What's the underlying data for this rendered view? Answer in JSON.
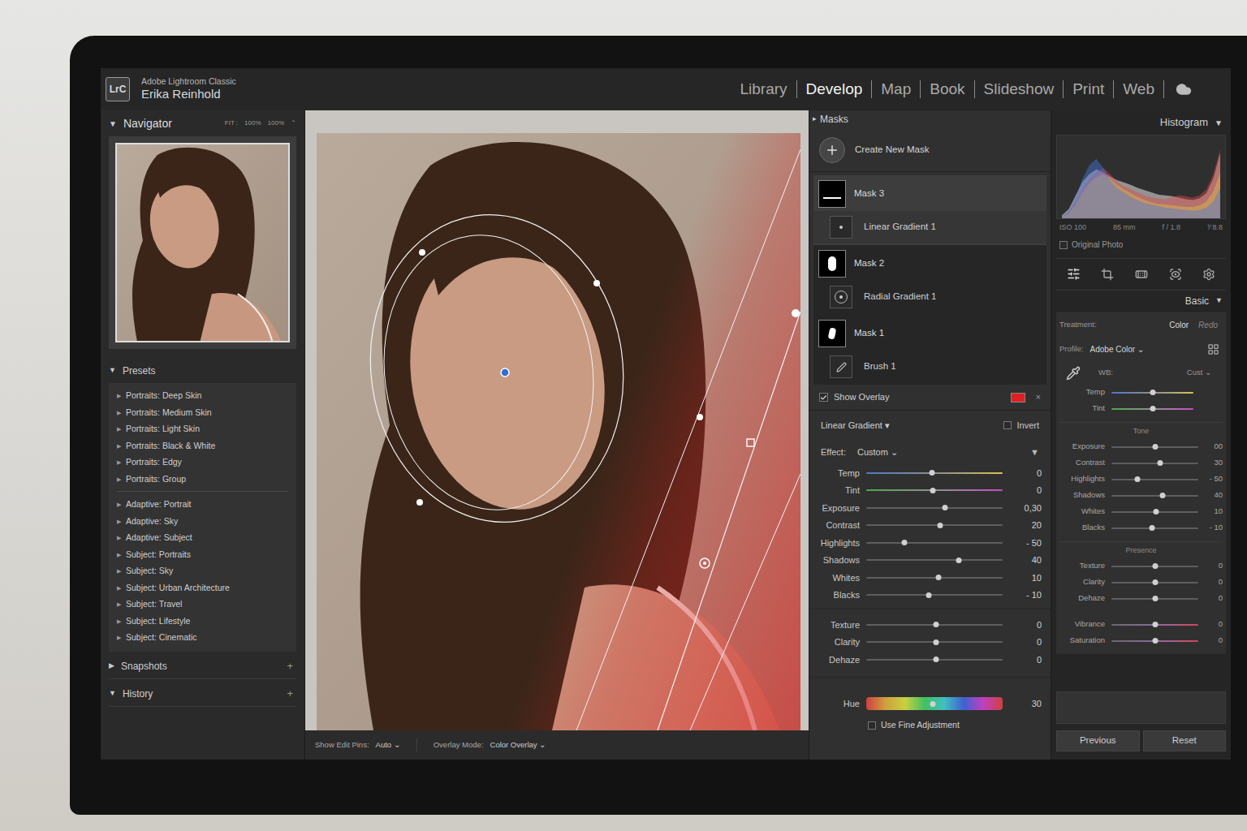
{
  "app": {
    "logo": "LrC",
    "product": "Adobe Lightroom Classic",
    "user": "Erika Reinhold"
  },
  "modules": [
    {
      "label": "Library",
      "selected": false
    },
    {
      "label": "Develop",
      "selected": true
    },
    {
      "label": "Map",
      "selected": false
    },
    {
      "label": "Book",
      "selected": false
    },
    {
      "label": "Slideshow",
      "selected": false
    },
    {
      "label": "Print",
      "selected": false
    },
    {
      "label": "Web",
      "selected": false
    }
  ],
  "navigator": {
    "toggle": "▼",
    "title": "Navigator",
    "expanded": true,
    "zoom": [
      "FIT :",
      "100%",
      "100%",
      "⌃"
    ]
  },
  "presets": {
    "toggle": "▼",
    "title": "Presets",
    "expanded": true,
    "item_toggle": "▶",
    "groups": [
      [
        "Portraits: Deep Skin",
        "Portraits: Medium Skin",
        "Portraits: Light Skin",
        "Portraits: Black & White",
        "Portraits: Edgy",
        "Portraits: Group"
      ],
      [
        "Adaptive: Portrait",
        "Adaptive: Sky",
        "Adaptive: Subject",
        "Subject: Portraits",
        "Subject: Sky",
        "Subject: Urban Architecture",
        "Subject: Travel",
        "Subject: Lifestyle",
        "Subject: Cinematic"
      ]
    ]
  },
  "snapshots": {
    "toggle": "▶",
    "title": "Snapshots",
    "expanded": false,
    "add": "+"
  },
  "history": {
    "toggle": "▼",
    "title": "History",
    "expanded": true,
    "add": "+"
  },
  "toolbar": {
    "edit_pins_label": "Show Edit Pins:",
    "edit_pins": "Auto",
    "overlay_label": "Overlay Mode:",
    "overlay_mode": "Color Overlay",
    "caret": "⌄"
  },
  "masks": {
    "toggle": "▸",
    "title": "Masks",
    "create": "Create New Mask",
    "items": [
      {
        "name": "Mask 3",
        "selected": true,
        "components": [
          {
            "name": "Linear Gradient 1",
            "kind": "linear",
            "selected": true
          }
        ]
      },
      {
        "name": "Mask 2",
        "selected": false,
        "components": [
          {
            "name": "Radial Gradient 1",
            "kind": "radial",
            "selected": false
          }
        ]
      },
      {
        "name": "Mask 1",
        "selected": false,
        "components": [
          {
            "name": "Brush 1",
            "kind": "brush",
            "selected": false
          }
        ]
      }
    ],
    "show_overlay": {
      "label": "Show Overlay",
      "checked": true,
      "color": "#e02020",
      "close": "×"
    }
  },
  "adjust": {
    "title": "Linear Gradient",
    "caret": "▾",
    "invert": {
      "label": "Invert",
      "checked": false
    },
    "effect_label": "Effect:",
    "effect": "Custom",
    "effect_caret": "⌄",
    "collapse": "▼",
    "groups": [
      [
        {
          "label": "Temp",
          "value": "0",
          "level": 0.48,
          "kind": "temp"
        },
        {
          "label": "Tint",
          "value": "0",
          "level": 0.49,
          "kind": "tint"
        },
        {
          "label": "Exposure",
          "value": "0,30",
          "level": 0.58,
          "kind": "plain"
        },
        {
          "label": "Contrast",
          "value": "20",
          "level": 0.54,
          "kind": "plain"
        },
        {
          "label": "Highlights",
          "value": "- 50",
          "level": 0.28,
          "kind": "plain"
        },
        {
          "label": "Shadows",
          "value": "40",
          "level": 0.68,
          "kind": "plain"
        },
        {
          "label": "Whites",
          "value": "10",
          "level": 0.53,
          "kind": "plain"
        },
        {
          "label": "Blacks",
          "value": "- 10",
          "level": 0.46,
          "kind": "plain"
        }
      ],
      [
        {
          "label": "Texture",
          "value": "0",
          "level": 0.51,
          "kind": "plain"
        },
        {
          "label": "Clarity",
          "value": "0",
          "level": 0.51,
          "kind": "plain"
        },
        {
          "label": "Dehaze",
          "value": "0",
          "level": 0.51,
          "kind": "plain"
        }
      ],
      [
        {
          "label": "Hue",
          "value": "30",
          "level": 0.49,
          "kind": "hue"
        }
      ]
    ],
    "fine": {
      "label": "Use Fine Adjustment",
      "checked": false
    }
  },
  "histogram": {
    "title": "Histogram",
    "toggle": "▼",
    "info": [
      "ISO 100",
      "85 mm",
      "f / 1.8",
      "⅟ 8.8"
    ],
    "original_photo": {
      "label": "Original Photo",
      "checked": false
    },
    "series": [
      {
        "name": "luminance",
        "color": "#bdbdbd",
        "values": [
          4,
          12,
          30,
          48,
          58,
          64,
          60,
          55,
          50,
          47,
          44,
          40,
          37,
          34,
          31,
          30,
          29,
          27,
          25,
          24,
          26,
          33,
          52,
          85
        ]
      },
      {
        "name": "red",
        "color": "#e04848",
        "values": [
          2,
          8,
          22,
          40,
          52,
          60,
          66,
          58,
          48,
          42,
          38,
          34,
          30,
          27,
          26,
          25,
          28,
          30,
          29,
          27,
          30,
          38,
          58,
          90
        ]
      },
      {
        "name": "green",
        "color": "#e0c040",
        "values": [
          2,
          6,
          18,
          34,
          46,
          54,
          58,
          52,
          44,
          38,
          33,
          28,
          24,
          21,
          19,
          18,
          17,
          16,
          15,
          15,
          17,
          22,
          35,
          60
        ]
      },
      {
        "name": "blue",
        "color": "#4878e0",
        "values": [
          3,
          10,
          28,
          52,
          70,
          78,
          66,
          50,
          40,
          34,
          28,
          24,
          20,
          18,
          16,
          14,
          13,
          12,
          11,
          10,
          11,
          14,
          22,
          40
        ]
      }
    ]
  },
  "basic": {
    "title": "Basic",
    "toggle": "▼",
    "treatment_label": "Treatment:",
    "treatment": [
      {
        "label": "Color",
        "selected": true
      },
      {
        "label": "Redo",
        "selected": false
      }
    ],
    "profile_label": "Profile:",
    "profile": "Adobe Color",
    "profile_caret": "⌄",
    "wb_label": "WB:",
    "wb": "Cust",
    "wb_caret": "⌄",
    "wb_sliders": [
      {
        "label": "Temp",
        "level": 0.5,
        "kind": "temp"
      },
      {
        "label": "Tint",
        "level": 0.5,
        "kind": "tint"
      }
    ],
    "tone_title": "Tone",
    "tone": [
      {
        "label": "Exposure",
        "value": "00",
        "level": 0.5,
        "kind": "plain"
      },
      {
        "label": "Contrast",
        "value": "30",
        "level": 0.56,
        "kind": "plain"
      },
      {
        "label": "Highlights",
        "value": "- 50",
        "level": 0.3,
        "kind": "plain"
      },
      {
        "label": "Shadows",
        "value": "40",
        "level": 0.59,
        "kind": "plain"
      },
      {
        "label": "Whites",
        "value": "10",
        "level": 0.51,
        "kind": "plain"
      },
      {
        "label": "Blacks",
        "value": "- 10",
        "level": 0.47,
        "kind": "plain"
      }
    ],
    "presence_title": "Presence",
    "presence": [
      {
        "label": "Texture",
        "value": "0",
        "level": 0.5,
        "kind": "plain"
      },
      {
        "label": "Clarity",
        "value": "0",
        "level": 0.5,
        "kind": "plain"
      },
      {
        "label": "Dehaze",
        "value": "0",
        "level": 0.5,
        "kind": "plain"
      }
    ],
    "color_sliders": [
      {
        "label": "Vibrance",
        "value": "0",
        "level": 0.5,
        "kind": "sat"
      },
      {
        "label": "Saturation",
        "value": "0",
        "level": 0.5,
        "kind": "sat"
      }
    ]
  },
  "buttons": [
    {
      "label": "Previous"
    },
    {
      "label": "Reset"
    }
  ]
}
